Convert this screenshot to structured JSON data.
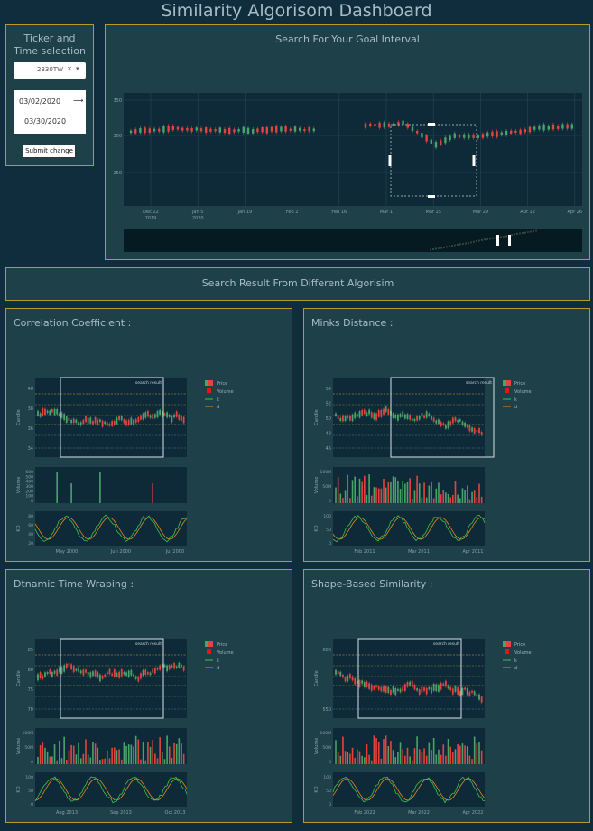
{
  "header": {
    "title": "Similarity Algorisom Dashboard"
  },
  "controls": {
    "title_line1": "Ticker and",
    "title_line2": "Time selection",
    "ticker": "2330TW",
    "start_date": "03/02/2020",
    "end_date": "03/30/2020",
    "submit_label": "Submit change",
    "clear_glyph": "×",
    "dropdown_glyph": "▾",
    "arrow_glyph": "⟶"
  },
  "search_panel": {
    "title": "Search For Your Goal Interval",
    "y_ticks": [
      "350",
      "300",
      "250"
    ],
    "x_ticks": [
      "Dec 22\n2019",
      "Jan 5\n2020",
      "Jan 19",
      "Feb 2",
      "Feb 16",
      "Mar 1",
      "Mar 15",
      "Mar 29",
      "Apr 12",
      "Apr 26"
    ]
  },
  "results_banner": {
    "title": "Search Result From Different Algorisim"
  },
  "legend": {
    "price": "Price",
    "volume": "Volume",
    "k": "k",
    "d": "d"
  },
  "axis_labels": {
    "candle": "Candle",
    "volume": "Volume",
    "kd": "KD"
  },
  "box_label": "search result",
  "colors": {
    "up": "#4aa36b",
    "down": "#e5433d",
    "k": "#3ec24a",
    "d": "#e58a1f",
    "accent": "#b89a2c"
  },
  "results": [
    {
      "title": "Correlation Coefficient :",
      "candle_ticks": [
        "40",
        "38",
        "36",
        "34"
      ],
      "volume_ticks": [
        "600",
        "500",
        "400",
        "300",
        "200",
        "100",
        "0"
      ],
      "kd_ticks": [
        "80",
        "60",
        "40",
        "20"
      ],
      "x_ticks": [
        "May 2000",
        "Jun 2000",
        "Jul 2000"
      ]
    },
    {
      "title": "Minks Distance :",
      "candle_ticks": [
        "54",
        "52",
        "50",
        "48",
        "46"
      ],
      "volume_ticks": [
        "100M",
        "50M",
        "0"
      ],
      "kd_ticks": [
        "100",
        "50",
        "0"
      ],
      "x_ticks": [
        "Feb 2011",
        "Mar 2011",
        "Apr 2011"
      ]
    },
    {
      "title": "Dtnamic Time Wraping :",
      "candle_ticks": [
        "85",
        "80",
        "75",
        "70"
      ],
      "volume_ticks": [
        "100M",
        "50M",
        "0"
      ],
      "kd_ticks": [
        "100",
        "50",
        "0"
      ],
      "x_ticks": [
        "Aug 2013",
        "Sep 2013",
        "Oct 2013"
      ]
    },
    {
      "title": "Shape-Based Similarity :",
      "candle_ticks": [
        "600",
        "550"
      ],
      "volume_ticks": [
        "100M",
        "50M",
        "0"
      ],
      "kd_ticks": [
        "100",
        "50",
        "0"
      ],
      "x_ticks": [
        "Feb 2022",
        "Mar 2022",
        "Apr 2022"
      ]
    }
  ]
}
